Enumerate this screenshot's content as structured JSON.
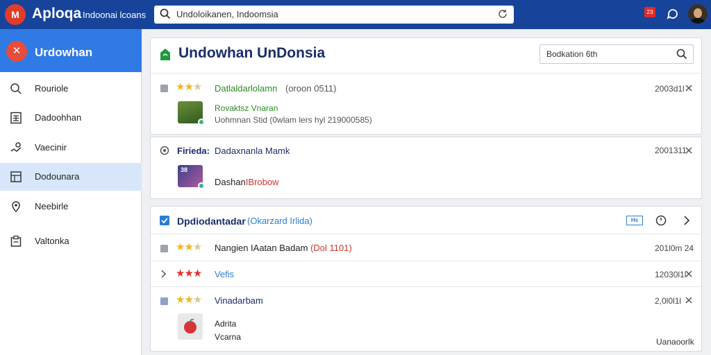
{
  "header": {
    "logo_text": "M",
    "app_name": "Aploqa",
    "app_subtitle": "Indoonai lcoans",
    "search_value": "Undoloikanen, Indoomsia",
    "notification_count": "23"
  },
  "sidebar": {
    "title": "Urdowhan",
    "items": [
      {
        "label": "Rouriole",
        "icon": "search-icon"
      },
      {
        "label": "Dadoohhan",
        "icon": "calculator-icon"
      },
      {
        "label": "Vaecinir",
        "icon": "map-icon"
      },
      {
        "label": "Dodounara",
        "icon": "dashboard-icon",
        "active": true
      },
      {
        "label": "Neebirle",
        "icon": "location-pin-icon"
      },
      {
        "label": "Valtonka",
        "icon": "clipboard-icon"
      }
    ]
  },
  "main": {
    "page_title": "Undowhan UnDonsia",
    "filter_placeholder": "Bodkation 6th",
    "card1": {
      "title": "Datlaldarlolamn",
      "title_extra": "(oroon 0511)",
      "time": "2003d1l",
      "rating": 3,
      "sub_title": "Rovaktsz Vnaran",
      "sub_detail": "Uohmnan Stid (0wlam lers hyl 219000585)"
    },
    "card2": {
      "label": "Firieda:",
      "title": "Dadaxnanla Mamk",
      "time": "2001311",
      "thumb_text": "38",
      "desc_a": "Dashan",
      "desc_b": "IBrobow"
    },
    "card3": {
      "header_title": "Dpdiodantadar",
      "header_extra": "(Okarzard Irlida)",
      "header_badge": "Hs",
      "rows": [
        {
          "name": "Nangien IAatan Badam",
          "extra": "(Dol 1101)",
          "time": "201l0m 24",
          "rating": 3,
          "stars_color": "gold",
          "marker": "checkbox"
        },
        {
          "name": "Vefis",
          "extra": "",
          "time": "12030l1l",
          "rating": 3,
          "stars_color": "red",
          "marker": "chevron"
        },
        {
          "name": "Vinadarbam",
          "extra": "",
          "time": "2,0l0l1l",
          "rating": 3,
          "stars_color": "gold",
          "marker": "checkbox"
        }
      ],
      "sub_a": "Adrita",
      "sub_b": "Vcarna",
      "footer_text": "Uanaoorlk"
    }
  }
}
